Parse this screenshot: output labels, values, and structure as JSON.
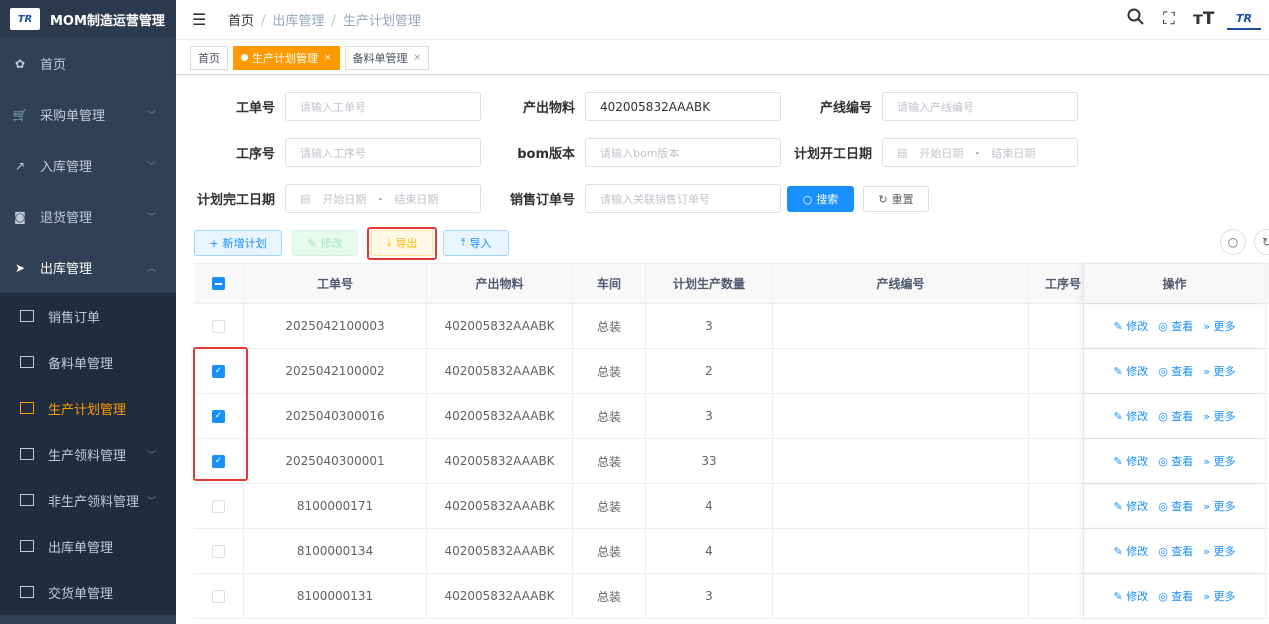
{
  "app": {
    "title": "MOM制造运营管理",
    "logo_text": "TR"
  },
  "sidebar": {
    "items": [
      {
        "label": "首页",
        "icon": "dashboard-icon",
        "glyph": "✿",
        "arrow": ""
      },
      {
        "label": "采购单管理",
        "icon": "cart-icon",
        "glyph": "🛒",
        "arrow": "﹀"
      },
      {
        "label": "入库管理",
        "icon": "import-icon",
        "glyph": "↗",
        "arrow": "﹀"
      },
      {
        "label": "退货管理",
        "icon": "return-icon",
        "glyph": "◙",
        "arrow": "﹀"
      },
      {
        "label": "出库管理",
        "icon": "send-icon",
        "glyph": "➤",
        "arrow": "︿"
      }
    ],
    "sub_items": [
      {
        "label": "销售订单",
        "arrow": ""
      },
      {
        "label": "备料单管理",
        "arrow": ""
      },
      {
        "label": "生产计划管理",
        "arrow": ""
      },
      {
        "label": "生产领料管理",
        "arrow": "﹀"
      },
      {
        "label": "非生产领料管理",
        "arrow": "﹀"
      },
      {
        "label": "出库单管理",
        "arrow": ""
      },
      {
        "label": "交货单管理",
        "arrow": ""
      }
    ]
  },
  "breadcrumb": [
    "首页",
    "出库管理",
    "生产计划管理"
  ],
  "tabs": [
    {
      "label": "首页"
    },
    {
      "label": "生产计划管理",
      "close": "×"
    },
    {
      "label": "备料单管理",
      "close": "×"
    }
  ],
  "filters": {
    "order_no": {
      "label": "工单号",
      "placeholder": "请输入工单号"
    },
    "output_material": {
      "label": "产出物料",
      "value": "402005832AAABK"
    },
    "line_no": {
      "label": "产线编号",
      "placeholder": "请输入产线编号"
    },
    "process_no": {
      "label": "工序号",
      "placeholder": "请输入工序号"
    },
    "bom_version": {
      "label": "bom版本",
      "placeholder": "请输入bom版本"
    },
    "plan_start": {
      "label": "计划开工日期",
      "start": "开始日期",
      "sep": "-",
      "end": "结束日期"
    },
    "plan_end": {
      "label": "计划完工日期",
      "start": "开始日期",
      "sep": "-",
      "end": "结束日期"
    },
    "sales_order": {
      "label": "销售订单号",
      "placeholder": "请输入关联销售订单号"
    },
    "search_label": "搜索",
    "reset_label": "重置"
  },
  "toolbar": {
    "add_label": "新增计划",
    "edit_label": "修改",
    "export_label": "导出",
    "import_label": "导入"
  },
  "table": {
    "columns": [
      "工单号",
      "产出物料",
      "车间",
      "计划生产数量",
      "产线编号",
      "工序号",
      "操作"
    ],
    "rows": [
      {
        "checked": false,
        "order": "2025042100003",
        "material": "402005832AAABK",
        "workshop": "总装",
        "qty": "3",
        "line": "",
        "process": ""
      },
      {
        "checked": true,
        "order": "2025042100002",
        "material": "402005832AAABK",
        "workshop": "总装",
        "qty": "2",
        "line": "",
        "process": ""
      },
      {
        "checked": true,
        "order": "2025040300016",
        "material": "402005832AAABK",
        "workshop": "总装",
        "qty": "3",
        "line": "",
        "process": ""
      },
      {
        "checked": true,
        "order": "2025040300001",
        "material": "402005832AAABK",
        "workshop": "总装",
        "qty": "33",
        "line": "",
        "process": ""
      },
      {
        "checked": false,
        "order": "8100000171",
        "material": "402005832AAABK",
        "workshop": "总装",
        "qty": "4",
        "line": "",
        "process": ""
      },
      {
        "checked": false,
        "order": "8100000134",
        "material": "402005832AAABK",
        "workshop": "总装",
        "qty": "4",
        "line": "",
        "process": ""
      },
      {
        "checked": false,
        "order": "8100000131",
        "material": "402005832AAABK",
        "workshop": "总装",
        "qty": "3",
        "line": "",
        "process": ""
      }
    ],
    "row_actions": {
      "edit": "修改",
      "view": "查看",
      "more": "更多"
    }
  },
  "colors": {
    "sidebar": "#304156",
    "accent": "#ff9b00",
    "primary": "#1890ff",
    "highlight": "#e53935"
  }
}
